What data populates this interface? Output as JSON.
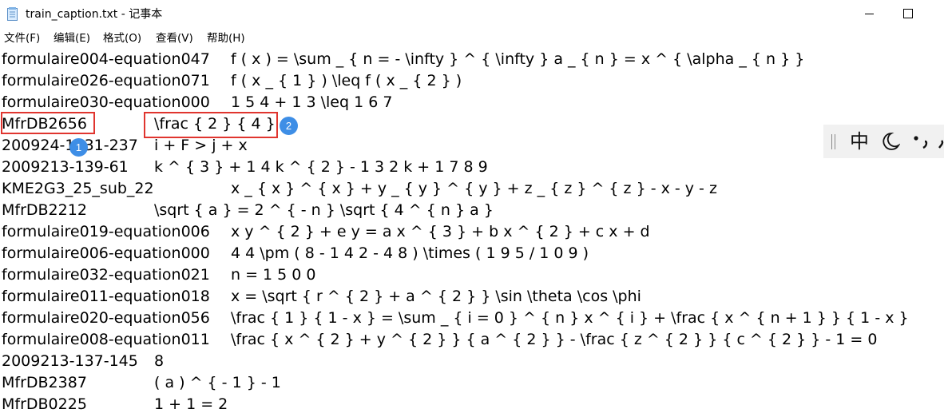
{
  "window": {
    "title": "train_caption.txt - 记事本"
  },
  "menu": [
    {
      "label": "文件(F)"
    },
    {
      "label": "编辑(E)"
    },
    {
      "label": "格式(O)"
    },
    {
      "label": "查看(V)"
    },
    {
      "label": "帮助(H)"
    }
  ],
  "lines": [
    {
      "id": "formulaire004-equation047",
      "eq": "f ( x ) = \\sum _ { n = - \\infty } ^ { \\infty } a _ { n } = x ^ { \\alpha _ { n } }"
    },
    {
      "id": "formulaire026-equation071",
      "eq": "f ( x _ { 1 } ) \\leq f ( x _ { 2 } )"
    },
    {
      "id": "formulaire030-equation000",
      "eq": "1 5 4 + 1 3 \\leq 1 6 7"
    },
    {
      "id": "MfrDB2656",
      "eq": "\\frac { 2 } { 4 }"
    },
    {
      "id": "200924-1131-237",
      "eq": "i + F > j + x"
    },
    {
      "id": "2009213-139-61",
      "eq": "k ^ { 3 } + 1 4 k ^ { 2 } - 1 3 2 k + 1 7 8 9"
    },
    {
      "id": "KME2G3_25_sub_22",
      "eq": "x _ { x } ^ { x } + y _ { y } ^ { y } + z _ { z } ^ { z } - x - y - z"
    },
    {
      "id": "MfrDB2212",
      "eq": "\\sqrt { a } = 2 ^ { - n } \\sqrt { 4 ^ { n } a }"
    },
    {
      "id": "formulaire019-equation006",
      "eq": "x y ^ { 2 } + e y = a x ^ { 3 } + b x ^ { 2 } + c x + d"
    },
    {
      "id": "formulaire006-equation000",
      "eq": "4 4 \\pm ( 8 - 1 4 2 - 4 8 ) \\times ( 1 9 5 / 1 0 9 )"
    },
    {
      "id": "formulaire032-equation021",
      "eq": "n = 1 5 0 0"
    },
    {
      "id": "formulaire011-equation018",
      "eq": "x = \\sqrt { r ^ { 2 } + a ^ { 2 } } \\sin \\theta \\cos \\phi"
    },
    {
      "id": "formulaire020-equation056",
      "eq": "\\frac { 1 } { 1 - x } = \\sum _ { i = 0 } ^ { n } x ^ { i } + \\frac { x ^ { n + 1 } } { 1 - x }"
    },
    {
      "id": "formulaire008-equation011",
      "eq": "\\frac { x ^ { 2 } + y ^ { 2 } } { a ^ { 2 } } - \\frac { z ^ { 2 } } { c ^ { 2 } } - 1 = 0"
    },
    {
      "id": "2009213-137-145",
      "eq": "8"
    },
    {
      "id": "MfrDB2387",
      "eq": "( a ) ^ { - 1 } - 1"
    },
    {
      "id": "MfrDB0225",
      "eq": "1 + 1 = 2"
    }
  ],
  "annotations": [
    {
      "label": "1",
      "color": "#e0352f",
      "badge_color": "#3e8ee6"
    },
    {
      "label": "2",
      "color": "#e0352f",
      "badge_color": "#3e8ee6"
    }
  ],
  "ime": {
    "mode": "中",
    "icons": [
      "moon-icon",
      "punctuation-icon",
      "more-icon"
    ]
  }
}
